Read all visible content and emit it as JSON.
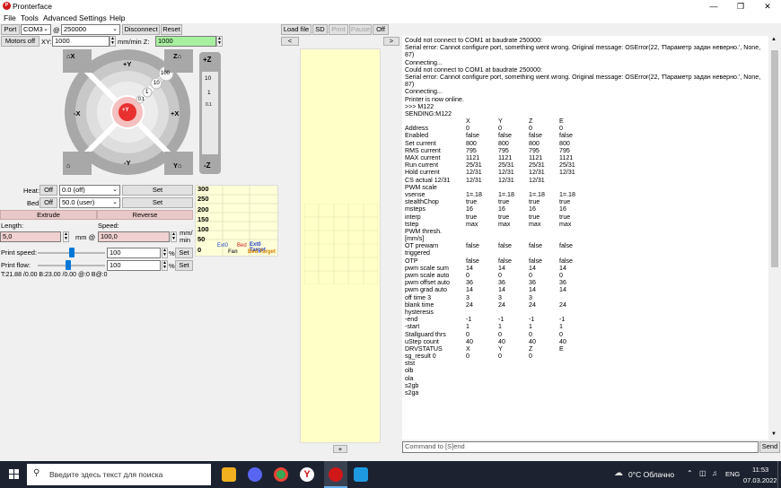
{
  "window": {
    "title": "Pronterface",
    "logo_text": "P"
  },
  "menu": [
    "File",
    "Tools",
    "Advanced",
    "Settings",
    "Help"
  ],
  "toolbar": {
    "port_label": "Port",
    "port_value": "COM3",
    "baud_at": "@",
    "baud_value": "250000",
    "disconnect": "Disconnect",
    "reset": "Reset",
    "motors_off": "Motors off",
    "xy_label": "XY:",
    "xy_value": "1000",
    "mm_min_z": "mm/min Z:",
    "z_value": "1000",
    "load_file": "Load file",
    "sd": "SD",
    "print": "Print",
    "pause": "Pause",
    "off": "Off",
    "collapse_left": "<",
    "collapse_right": ">"
  },
  "jog": {
    "home_x": "X",
    "home_y": "Y",
    "home_z": "Z",
    "home_all": "",
    "plus_y": "+Y",
    "minus_y": "-Y",
    "plus_x": "+X",
    "minus_x": "-X",
    "plus_z": "+Z",
    "minus_z": "-Z",
    "center": "+Y",
    "steps": [
      "100",
      "10",
      "1",
      "0.1"
    ],
    "z_steps": [
      "10",
      "1",
      "0.1"
    ]
  },
  "temps": {
    "heat_label": "Heat:",
    "heat_off": "Off",
    "heat_value": "0.0 (off)",
    "heat_set": "Set",
    "bed_label": "Bed:",
    "bed_off": "Off",
    "bed_value": "50.0 (user)",
    "bed_set": "Set"
  },
  "extrude": {
    "extrude": "Extrude",
    "reverse": "Reverse",
    "length_label": "Length:",
    "speed_label": "Speed:",
    "length_value": "5,0",
    "mm_at": "mm @",
    "speed_value": "100,0",
    "mm_min": "mm/\nmin"
  },
  "speeds": {
    "print_speed_label": "Print speed:",
    "print_speed_value": "100",
    "print_speed_fraction": 0.5,
    "print_flow_label": "Print flow:",
    "print_flow_value": "100",
    "print_flow_fraction": 0.45,
    "pct": "%",
    "set": "Set"
  },
  "status_line": "T:21.88 /0.00 B:23.00 /0.00 @:0 B@:0",
  "graph": {
    "y_ticks": [
      "300",
      "250",
      "200",
      "150",
      "100",
      "50",
      "0"
    ],
    "legend": [
      "Ext0",
      "Bed",
      "Ext0 Target",
      "Fan",
      "Bed Target"
    ],
    "colors": {
      "ext0": "#1f3fd0",
      "bed": "#d01818",
      "ext0_target": "#1f3fd0",
      "fan": "#404040",
      "bed_target": "#d08000"
    }
  },
  "preview": {
    "plus": "+"
  },
  "console": {
    "lines": [
      [
        "Could not connect to COM1 at baudrate 250000:"
      ],
      [
        "Serial error: Cannot configure port, something went wrong. Original message: OSError(22, 'Параметр задан неверно.', None,"
      ],
      [
        "87)"
      ],
      [
        "Connecting..."
      ],
      [
        "Could not connect to COM1 at baudrate 250000:"
      ],
      [
        "Serial error: Cannot configure port, something went wrong. Original message: OSError(22, 'Параметр задан неверно.', None,"
      ],
      [
        "87)"
      ],
      [
        "Connecting..."
      ],
      [
        "Printer is now online."
      ],
      [
        ">>> M122"
      ],
      [
        "SENDING:M122"
      ],
      [
        "",
        "X",
        "Y",
        "Z",
        "E"
      ],
      [
        "Address",
        "0",
        "0",
        "0",
        "0"
      ],
      [
        "Enabled",
        "false",
        "false",
        "false",
        "false"
      ],
      [
        "Set current",
        "800",
        "800",
        "800",
        "800"
      ],
      [
        "RMS current",
        "795",
        "795",
        "795",
        "795"
      ],
      [
        "MAX current",
        "1121",
        "1121",
        "1121",
        "1121"
      ],
      [
        "Run current",
        "25/31",
        "25/31",
        "25/31",
        "25/31"
      ],
      [
        "Hold current",
        "12/31",
        "12/31",
        "12/31",
        "12/31"
      ],
      [
        "CS actual  12/31",
        "12/31",
        "12/31",
        "12/31",
        ""
      ],
      [
        "PWM scale"
      ],
      [
        "vsense",
        "1=.18",
        "1=.18",
        "1=.18",
        "1=.18"
      ],
      [
        "stealthChop",
        "true",
        "true",
        "true",
        "true"
      ],
      [
        "msteps",
        "16",
        "16",
        "16",
        "16"
      ],
      [
        "interp",
        "true",
        "true",
        "true",
        "true"
      ],
      [
        "tstep",
        "max",
        "max",
        "max",
        "max"
      ],
      [
        "PWM thresh."
      ],
      [
        "[mm/s]"
      ],
      [
        "OT prewarn",
        "false",
        "false",
        "false",
        "false"
      ],
      [
        "triggered"
      ],
      [
        " OTP",
        "false",
        "false",
        "false",
        "false"
      ],
      [
        "pwm scale sum",
        "14",
        "14",
        "14",
        "14"
      ],
      [
        "pwm scale auto",
        "0",
        "0",
        "0",
        "0"
      ],
      [
        "pwm offset auto",
        "36",
        "36",
        "36",
        "36"
      ],
      [
        "pwm grad auto",
        "14",
        "14",
        "14",
        "14"
      ],
      [
        "off time   3",
        "3",
        "3",
        "3",
        ""
      ],
      [
        "blank time",
        "24",
        "24",
        "24",
        "24"
      ],
      [
        "hysteresis"
      ],
      [
        "-end",
        "-1",
        "-1",
        "-1",
        "-1"
      ],
      [
        "-start",
        "1",
        "1",
        "1",
        "1"
      ],
      [
        "Stallguard thrs",
        "0",
        "0",
        "0",
        "0"
      ],
      [
        "uStep count",
        "40",
        "40",
        "40",
        "40"
      ],
      [
        "DRVSTATUS",
        "X",
        "Y",
        "Z",
        "E"
      ],
      [
        "sg_result  0",
        "0",
        "0",
        "0",
        ""
      ],
      [
        "stst"
      ],
      [
        "olb"
      ],
      [
        "ola"
      ],
      [
        "s2gb"
      ],
      [
        "s2ga"
      ]
    ],
    "command_placeholder": "Command to [S]end",
    "send": "Send"
  },
  "taskbar": {
    "search_placeholder": "Введите здесь текст для поиска",
    "weather": "0°C  Облачно",
    "lang": "ENG",
    "time": "11:53",
    "date": "07.03.2022"
  }
}
